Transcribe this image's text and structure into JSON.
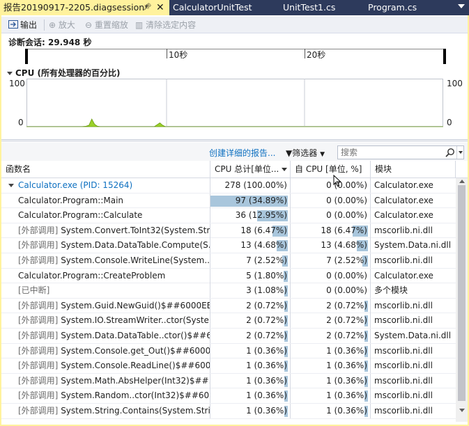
{
  "tabs": [
    {
      "label": "报告20190917-2205.diagsession*",
      "active": true
    },
    {
      "label": "CalculatorUnitTest",
      "active": false
    },
    {
      "label": "UnitTest1.cs",
      "active": false
    },
    {
      "label": "Program.cs",
      "active": false
    }
  ],
  "toolbar": {
    "output": "输出",
    "zoom_in": "放大",
    "reset_zoom": "重置缩放",
    "clear_selection": "清除选定内容"
  },
  "session": {
    "label": "诊断会话: 29.948 秒"
  },
  "ruler": {
    "labels": [
      "10秒",
      "20秒"
    ]
  },
  "cpu": {
    "title": "CPU (所有处理器的百分比)",
    "y_max_left": "100",
    "y_min_left": "0",
    "y_max_right": "100",
    "y_min_right": "0"
  },
  "chart_data": {
    "type": "area",
    "title": "CPU (所有处理器的百分比)",
    "xlabel": "",
    "ylabel": "",
    "ylim": [
      0,
      100
    ],
    "xlim": [
      0,
      30
    ],
    "x": [
      0,
      4.0,
      4.3,
      4.5,
      4.7,
      4.9,
      5.1,
      5.3,
      9.2,
      9.4,
      9.6,
      9.8,
      10.0,
      30
    ],
    "values": [
      0,
      0,
      1,
      3,
      16,
      5,
      1,
      0,
      0,
      4,
      8,
      3,
      0,
      0
    ],
    "color": "#9bd12a",
    "grid": true
  },
  "options": {
    "create_report": "创建详细的报告...",
    "filter": "筛选器",
    "search_placeholder": "搜索"
  },
  "columns": [
    "函数名",
    "CPU 总计[单位...",
    "自 CPU [单位, %]",
    "模块"
  ],
  "rows": [
    {
      "prefix": "",
      "name": "Calculator.exe (PID: 15264)",
      "total": "278 (100.00%)",
      "total_pct": 1.0,
      "self": "0 (0.00%)",
      "self_pct": 0,
      "module": "Calculator.exe",
      "root": true
    },
    {
      "prefix": "",
      "name": "Calculator.Program::Main",
      "total": "97 (34.89%)",
      "total_pct": 0.3489,
      "self": "0 (0.00%)",
      "self_pct": 0,
      "module": "Calculator.exe"
    },
    {
      "prefix": "",
      "name": "Calculator.Program::Calculate",
      "total": "36 (12.95%)",
      "total_pct": 0.1295,
      "self": "0 (0.00%)",
      "self_pct": 0,
      "module": "Calculator.exe"
    },
    {
      "prefix": "[外部调用]",
      "name": " System.Convert.ToInt32(System.Str...",
      "total": "18 (6.47%)",
      "total_pct": 0.0647,
      "self": "18 (6.47%)",
      "self_pct": 0.0647,
      "module": "mscorlib.ni.dll"
    },
    {
      "prefix": "[外部调用]",
      "name": " System.Data.DataTable.Compute(S...",
      "total": "13 (4.68%)",
      "total_pct": 0.0468,
      "self": "13 (4.68%)",
      "self_pct": 0.0468,
      "module": "System.Data.ni.dll"
    },
    {
      "prefix": "[外部调用]",
      "name": " System.Console.WriteLine(System....",
      "total": "7 (2.52%)",
      "total_pct": 0.0252,
      "self": "7 (2.52%)",
      "self_pct": 0.0252,
      "module": "mscorlib.ni.dll"
    },
    {
      "prefix": "",
      "name": "Calculator.Program::CreateProblem",
      "total": "5 (1.80%)",
      "total_pct": 0.018,
      "self": "0 (0.00%)",
      "self_pct": 0,
      "module": "Calculator.exe"
    },
    {
      "prefix": "[已中断]",
      "name": "",
      "total": "3 (1.08%)",
      "total_pct": 0.0108,
      "self": "0 (0.00%)",
      "self_pct": 0,
      "module": "多个模块"
    },
    {
      "prefix": "[外部调用]",
      "name": " System.Guid.NewGuid()$##6000EEF",
      "total": "2 (0.72%)",
      "total_pct": 0.0072,
      "self": "2 (0.72%)",
      "self_pct": 0.0072,
      "module": "mscorlib.ni.dll"
    },
    {
      "prefix": "[外部调用]",
      "name": " System.IO.StreamWriter..ctor(Syste...",
      "total": "2 (0.72%)",
      "total_pct": 0.0072,
      "self": "2 (0.72%)",
      "self_pct": 0.0072,
      "module": "mscorlib.ni.dll"
    },
    {
      "prefix": "[外部调用]",
      "name": " System.Data.DataTable..ctor()$##6...",
      "total": "2 (0.72%)",
      "total_pct": 0.0072,
      "self": "2 (0.72%)",
      "self_pct": 0.0072,
      "module": "System.Data.ni.dll"
    },
    {
      "prefix": "[外部调用]",
      "name": " System.Console.get_Out()$##6000...",
      "total": "1 (0.36%)",
      "total_pct": 0.0036,
      "self": "1 (0.36%)",
      "self_pct": 0.0036,
      "module": "mscorlib.ni.dll"
    },
    {
      "prefix": "[外部调用]",
      "name": " System.Console.ReadLine()$##600...",
      "total": "1 (0.36%)",
      "total_pct": 0.0036,
      "self": "1 (0.36%)",
      "self_pct": 0.0036,
      "module": "mscorlib.ni.dll"
    },
    {
      "prefix": "[外部调用]",
      "name": " System.Math.AbsHelper(Int32)$##...",
      "total": "1 (0.36%)",
      "total_pct": 0.0036,
      "self": "1 (0.36%)",
      "self_pct": 0.0036,
      "module": "mscorlib.ni.dll"
    },
    {
      "prefix": "[外部调用]",
      "name": " System.Random..ctor(Int32)$##60...",
      "total": "1 (0.36%)",
      "total_pct": 0.0036,
      "self": "1 (0.36%)",
      "self_pct": 0.0036,
      "module": "mscorlib.ni.dll"
    },
    {
      "prefix": "[外部调用]",
      "name": " System.String.Contains(System.Stri...",
      "total": "1 (0.36%)",
      "total_pct": 0.0036,
      "self": "1 (0.36%)",
      "self_pct": 0.0036,
      "module": "mscorlib.ni.dll"
    }
  ],
  "colors": {
    "tab_bar": "#2d3a5c",
    "active_tab": "#fff29d",
    "link": "#0e70c0",
    "bar": "#a9c6dc",
    "cpu_area": "#9bd12a"
  }
}
